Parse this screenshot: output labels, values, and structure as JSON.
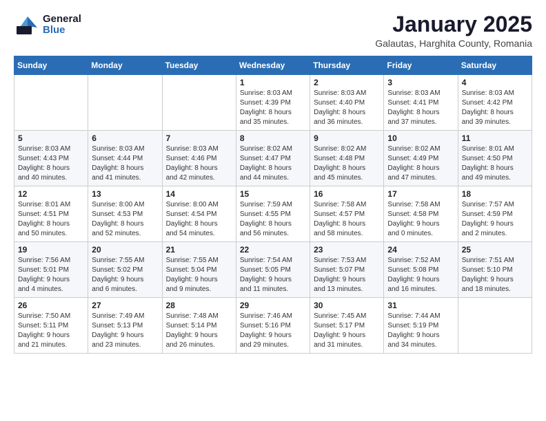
{
  "header": {
    "logo_general": "General",
    "logo_blue": "Blue",
    "title": "January 2025",
    "subtitle": "Galautas, Harghita County, Romania"
  },
  "weekdays": [
    "Sunday",
    "Monday",
    "Tuesday",
    "Wednesday",
    "Thursday",
    "Friday",
    "Saturday"
  ],
  "weeks": [
    [
      {
        "day": "",
        "info": ""
      },
      {
        "day": "",
        "info": ""
      },
      {
        "day": "",
        "info": ""
      },
      {
        "day": "1",
        "info": "Sunrise: 8:03 AM\nSunset: 4:39 PM\nDaylight: 8 hours\nand 35 minutes."
      },
      {
        "day": "2",
        "info": "Sunrise: 8:03 AM\nSunset: 4:40 PM\nDaylight: 8 hours\nand 36 minutes."
      },
      {
        "day": "3",
        "info": "Sunrise: 8:03 AM\nSunset: 4:41 PM\nDaylight: 8 hours\nand 37 minutes."
      },
      {
        "day": "4",
        "info": "Sunrise: 8:03 AM\nSunset: 4:42 PM\nDaylight: 8 hours\nand 39 minutes."
      }
    ],
    [
      {
        "day": "5",
        "info": "Sunrise: 8:03 AM\nSunset: 4:43 PM\nDaylight: 8 hours\nand 40 minutes."
      },
      {
        "day": "6",
        "info": "Sunrise: 8:03 AM\nSunset: 4:44 PM\nDaylight: 8 hours\nand 41 minutes."
      },
      {
        "day": "7",
        "info": "Sunrise: 8:03 AM\nSunset: 4:46 PM\nDaylight: 8 hours\nand 42 minutes."
      },
      {
        "day": "8",
        "info": "Sunrise: 8:02 AM\nSunset: 4:47 PM\nDaylight: 8 hours\nand 44 minutes."
      },
      {
        "day": "9",
        "info": "Sunrise: 8:02 AM\nSunset: 4:48 PM\nDaylight: 8 hours\nand 45 minutes."
      },
      {
        "day": "10",
        "info": "Sunrise: 8:02 AM\nSunset: 4:49 PM\nDaylight: 8 hours\nand 47 minutes."
      },
      {
        "day": "11",
        "info": "Sunrise: 8:01 AM\nSunset: 4:50 PM\nDaylight: 8 hours\nand 49 minutes."
      }
    ],
    [
      {
        "day": "12",
        "info": "Sunrise: 8:01 AM\nSunset: 4:51 PM\nDaylight: 8 hours\nand 50 minutes."
      },
      {
        "day": "13",
        "info": "Sunrise: 8:00 AM\nSunset: 4:53 PM\nDaylight: 8 hours\nand 52 minutes."
      },
      {
        "day": "14",
        "info": "Sunrise: 8:00 AM\nSunset: 4:54 PM\nDaylight: 8 hours\nand 54 minutes."
      },
      {
        "day": "15",
        "info": "Sunrise: 7:59 AM\nSunset: 4:55 PM\nDaylight: 8 hours\nand 56 minutes."
      },
      {
        "day": "16",
        "info": "Sunrise: 7:58 AM\nSunset: 4:57 PM\nDaylight: 8 hours\nand 58 minutes."
      },
      {
        "day": "17",
        "info": "Sunrise: 7:58 AM\nSunset: 4:58 PM\nDaylight: 9 hours\nand 0 minutes."
      },
      {
        "day": "18",
        "info": "Sunrise: 7:57 AM\nSunset: 4:59 PM\nDaylight: 9 hours\nand 2 minutes."
      }
    ],
    [
      {
        "day": "19",
        "info": "Sunrise: 7:56 AM\nSunset: 5:01 PM\nDaylight: 9 hours\nand 4 minutes."
      },
      {
        "day": "20",
        "info": "Sunrise: 7:55 AM\nSunset: 5:02 PM\nDaylight: 9 hours\nand 6 minutes."
      },
      {
        "day": "21",
        "info": "Sunrise: 7:55 AM\nSunset: 5:04 PM\nDaylight: 9 hours\nand 9 minutes."
      },
      {
        "day": "22",
        "info": "Sunrise: 7:54 AM\nSunset: 5:05 PM\nDaylight: 9 hours\nand 11 minutes."
      },
      {
        "day": "23",
        "info": "Sunrise: 7:53 AM\nSunset: 5:07 PM\nDaylight: 9 hours\nand 13 minutes."
      },
      {
        "day": "24",
        "info": "Sunrise: 7:52 AM\nSunset: 5:08 PM\nDaylight: 9 hours\nand 16 minutes."
      },
      {
        "day": "25",
        "info": "Sunrise: 7:51 AM\nSunset: 5:10 PM\nDaylight: 9 hours\nand 18 minutes."
      }
    ],
    [
      {
        "day": "26",
        "info": "Sunrise: 7:50 AM\nSunset: 5:11 PM\nDaylight: 9 hours\nand 21 minutes."
      },
      {
        "day": "27",
        "info": "Sunrise: 7:49 AM\nSunset: 5:13 PM\nDaylight: 9 hours\nand 23 minutes."
      },
      {
        "day": "28",
        "info": "Sunrise: 7:48 AM\nSunset: 5:14 PM\nDaylight: 9 hours\nand 26 minutes."
      },
      {
        "day": "29",
        "info": "Sunrise: 7:46 AM\nSunset: 5:16 PM\nDaylight: 9 hours\nand 29 minutes."
      },
      {
        "day": "30",
        "info": "Sunrise: 7:45 AM\nSunset: 5:17 PM\nDaylight: 9 hours\nand 31 minutes."
      },
      {
        "day": "31",
        "info": "Sunrise: 7:44 AM\nSunset: 5:19 PM\nDaylight: 9 hours\nand 34 minutes."
      },
      {
        "day": "",
        "info": ""
      }
    ]
  ]
}
